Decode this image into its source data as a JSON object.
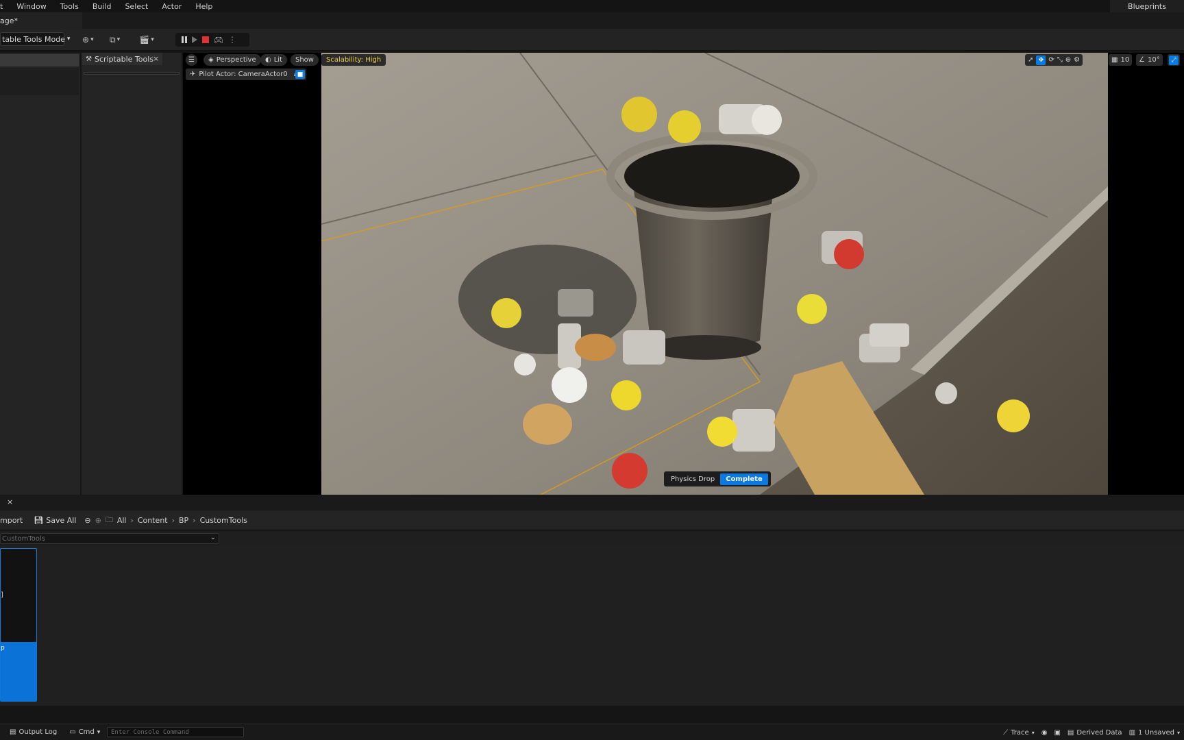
{
  "menu": {
    "items": [
      "t",
      "Window",
      "Tools",
      "Build",
      "Select",
      "Actor",
      "Help"
    ],
    "right_tab": "Blueprints"
  },
  "level_tab": {
    "title": "age*"
  },
  "toolbar": {
    "mode_label": "table Tools Mode"
  },
  "scriptable_tools": {
    "tab_label": "Scriptable Tools",
    "close": "×"
  },
  "viewport": {
    "perspective_label": "Perspective",
    "lit_label": "Lit",
    "show_label": "Show",
    "scalability_label": "Scalability: High",
    "pilot_label": "Pilot Actor: CameraActor0",
    "grid_value": "10",
    "angle_value": "10°",
    "toast_label": "Physics Drop",
    "toast_status": "Complete"
  },
  "content_browser": {
    "import_label": "mport",
    "save_all_label": "Save All",
    "breadcrumbs": [
      "All",
      "Content",
      "BP",
      "CustomTools"
    ],
    "filter_path": "CustomTools",
    "asset_thumb_glyph": "]",
    "asset_label": "p"
  },
  "statusbar": {
    "output_log": "Output Log",
    "cmd": "Cmd",
    "console_placeholder": "Enter Console Command",
    "trace": "Trace",
    "derived_data": "Derived Data",
    "unsaved": "1 Unsaved"
  },
  "colors": {
    "accent": "#0b7ae0",
    "stop": "#e03232",
    "scalability_text": "#e9d24b"
  }
}
